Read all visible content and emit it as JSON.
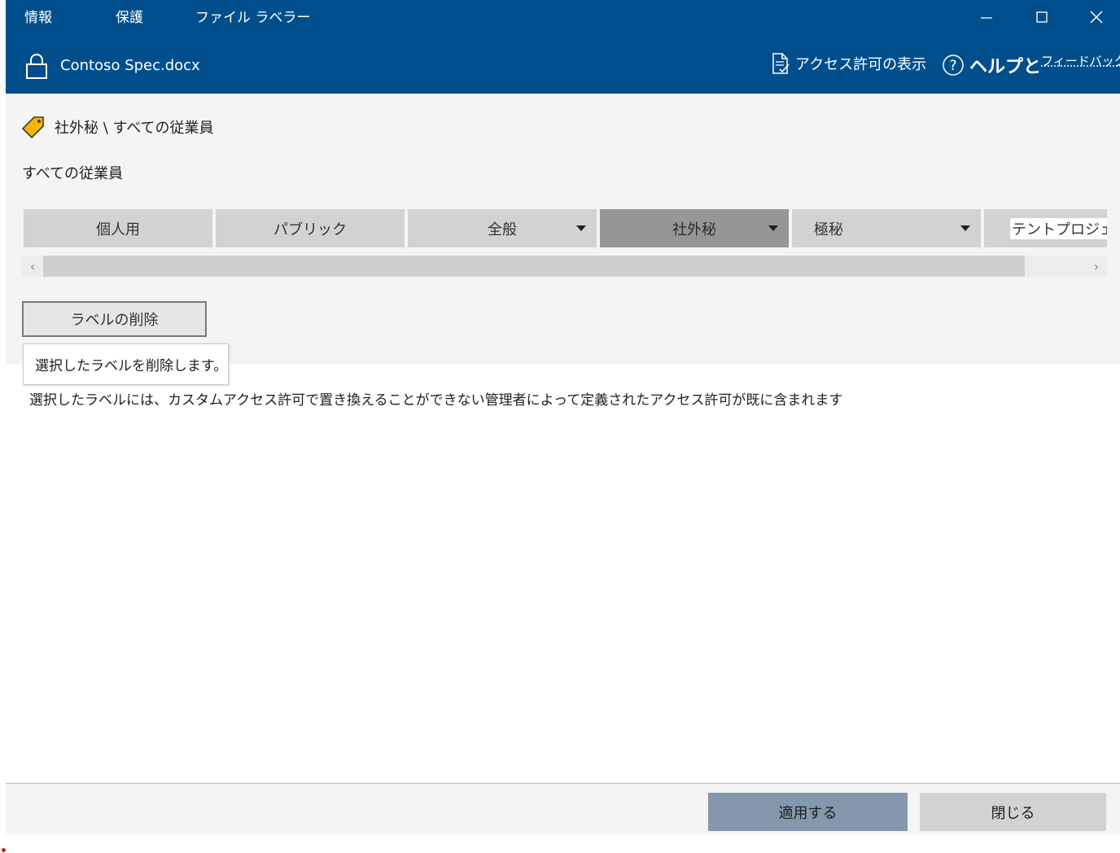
{
  "window": {
    "menu": [
      "情報",
      "保護",
      "ファイル ラベラー"
    ],
    "filename": "Contoso Spec.docx",
    "header_links": {
      "permissions": "アクセス許可の表示",
      "help": "ヘルプと",
      "feedback": "フィードバック"
    }
  },
  "label": {
    "path": "社外秘 \\ すべての従業員",
    "description": "すべての従業員"
  },
  "label_buttons": [
    {
      "text": "個人用",
      "has_dropdown": false,
      "selected": false
    },
    {
      "text": "パブリック",
      "has_dropdown": false,
      "selected": false
    },
    {
      "text": "全般",
      "has_dropdown": true,
      "selected": false
    },
    {
      "text": "社外秘",
      "has_dropdown": true,
      "selected": true
    },
    {
      "text": "極秘",
      "has_dropdown": true,
      "selected": false
    },
    {
      "text": "テントプロジェクト",
      "has_dropdown": false,
      "selected": false
    }
  ],
  "scroll": {
    "left_arrow": "‹",
    "right_arrow": "›"
  },
  "actions": {
    "remove_label": "ラベルの削除",
    "remove_tooltip": "選択したラベルを削除します。"
  },
  "notice": "選択したラベルには、カスタムアクセス許可で置き換えることができない管理者によって定義されたアクセス許可が既に含まれます",
  "footer": {
    "apply": "適用する",
    "close": "閉じる"
  },
  "colors": {
    "title_bar": "#004f8c",
    "content_bg": "#f4f4f4",
    "label_button": "#d2d2d2",
    "label_button_selected": "#969696",
    "apply_button": "#8497ad",
    "close_button": "#d2d2d2",
    "tag_icon": "#f5b800"
  },
  "icons": {
    "lock": "lock-icon",
    "tag": "tag-icon",
    "permissions": "document-check-icon",
    "help": "question-circle-icon",
    "minimize": "minimize-icon",
    "maximize": "maximize-icon",
    "close": "close-icon"
  }
}
